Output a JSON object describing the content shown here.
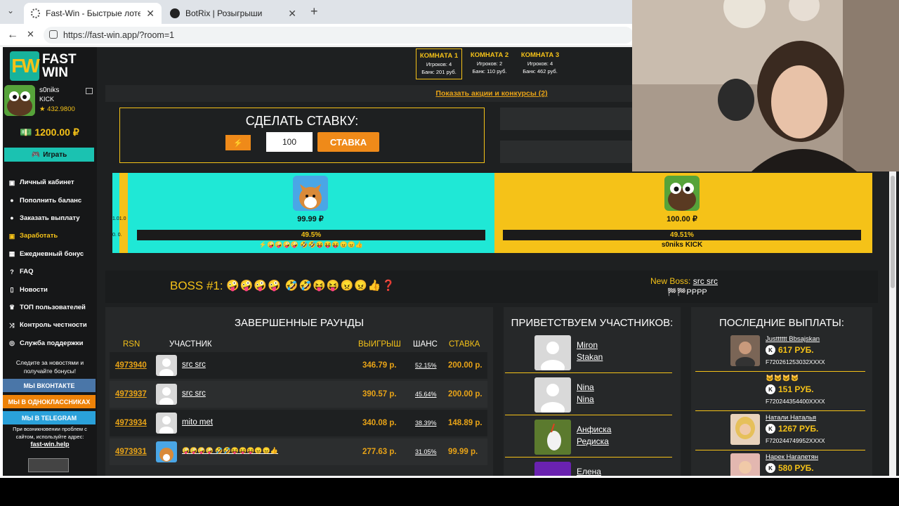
{
  "browser": {
    "tabs": [
      {
        "title": "Fast-Win - Быстрые лотереи! Ком",
        "active": true
      },
      {
        "title": "BotRix | Розыгрыши",
        "active": false
      }
    ],
    "url": "https://fast-win.app/?room=1",
    "new_tab_icon": "plus-icon"
  },
  "sidebar": {
    "logo_mark": "FW",
    "logo_line1": "FAST",
    "logo_line2": "WIN",
    "user_name": "s0niks",
    "user_sub": "KICK",
    "user_points": "★ 432.9800",
    "balance": "1200.00 ₽",
    "play_label": "Играть",
    "menu": [
      {
        "label": "Личный кабинет",
        "icon": "wallet-icon"
      },
      {
        "label": "Пополнить баланс",
        "icon": "deposit-icon"
      },
      {
        "label": "Заказать выплату",
        "icon": "withdraw-icon"
      },
      {
        "label": "Заработать",
        "icon": "earn-icon"
      },
      {
        "label": "Ежедневный бонус",
        "icon": "gift-icon"
      },
      {
        "label": "FAQ",
        "icon": "question-icon"
      },
      {
        "label": "Новости",
        "icon": "bookmark-icon"
      },
      {
        "label": "ТОП пользователей",
        "icon": "trophy-icon"
      },
      {
        "label": "Контроль честности",
        "icon": "shuffle-icon"
      },
      {
        "label": "Служба поддержки",
        "icon": "support-icon"
      }
    ],
    "follow_text": "Следите за новостями и получайте бонусы!",
    "social": {
      "vk": "МЫ ВКОНТАКТЕ",
      "ok": "МЫ В ОДНОКЛАССНИКАХ",
      "tg": "МЫ В TELEGRAM"
    },
    "support_text": "При возникновении проблем с сайтом, используйте адрес:",
    "support_link": "fast-win.help"
  },
  "rooms": [
    {
      "title": "КОМНАТА 1",
      "players": "Игроков: 4",
      "bank": "Банк: 201 руб.",
      "selected": true
    },
    {
      "title": "КОМНАТА 2",
      "players": "Игроков: 2",
      "bank": "Банк: 110 руб.",
      "selected": false
    },
    {
      "title": "КОМНАТА 3",
      "players": "Игроков: 4",
      "bank": "Банк: 462 руб.",
      "selected": false
    }
  ],
  "promos_link": "Показать акции и конкурсы (2)",
  "bet": {
    "title": "СДЕЛАТЬ СТАВКУ:",
    "amount": "100",
    "submit_label": "СТАВКА"
  },
  "arena": {
    "strip_labels": [
      "1.01.0",
      "0. 0."
    ],
    "team_a": {
      "amount": "99.99 ₽",
      "percent": "49.5%",
      "share": 49.5,
      "emoji": "⚡🤪🤪🤪🤪 🤣🤣😝😝😝😠😠👍"
    },
    "team_b": {
      "amount": "100.00 ₽",
      "percent": "49.51%",
      "share": 49.51,
      "name": "s0niks KICK"
    }
  },
  "boss": {
    "label": "BOSS #1:",
    "emoji": "🤪🤪🤪🤪 🤣🤣😝😝😠😠👍❓",
    "new_boss_prefix": "New Boss:",
    "new_boss_name": "src src",
    "new_boss_sub": "🏁🏁PPPP"
  },
  "rounds": {
    "title": "ЗАВЕРШЕННЫЕ РАУНДЫ",
    "headers": {
      "rsn": "RSN",
      "player": "УЧАСТНИК",
      "win": "ВЫИГРЫШ",
      "chance": "ШАНС",
      "bet": "СТАВКА"
    },
    "rows": [
      {
        "rsn": "4973940",
        "name": "src src",
        "win": "346.79 р.",
        "chance": "52.15%",
        "bet": "200.00 р."
      },
      {
        "rsn": "4973937",
        "name": "src src",
        "win": "390.57 р.",
        "chance": "45.64%",
        "bet": "200.00 р."
      },
      {
        "rsn": "4973934",
        "name": "mito met",
        "win": "340.08 р.",
        "chance": "38.39%",
        "bet": "148.89 р."
      },
      {
        "rsn": "4973931",
        "name": "🤪🤪🤪🤪 🤣🤣😝😝😝😠😠👍",
        "win": "277.63 р.",
        "chance": "31.05%",
        "bet": "99.99 р."
      }
    ]
  },
  "welcome": {
    "title": "ПРИВЕТСТВУЕМ УЧАСТНИКОВ:",
    "rows": [
      {
        "first": "Miron",
        "last": "Stakan"
      },
      {
        "first": "Nina",
        "last": "Nina"
      },
      {
        "first": "Анфиска",
        "last": "Редиска"
      },
      {
        "first": "Елена",
        "last": ""
      }
    ]
  },
  "payouts": {
    "title": "ПОСЛЕДНИЕ ВЫПЛАТЫ:",
    "rows": [
      {
        "name": "Justttttt Bbsajskan",
        "amount": "617 РУБ.",
        "id": "F720261253032XXXX"
      },
      {
        "name": "🐱🐱🐱🐱",
        "amount": "151 РУБ.",
        "id": "F720244354400XXXX"
      },
      {
        "name": "Натали Наталья",
        "amount": "1267 РУБ.",
        "id": "F720244749952XXXX"
      },
      {
        "name": "Нарек Нагапетян",
        "amount": "580 РУБ.",
        "id": ""
      }
    ]
  },
  "colors": {
    "accent": "#f5c218",
    "teal": "#1fe8d6",
    "orange": "#ef8a19",
    "bg": "#1e2021"
  }
}
